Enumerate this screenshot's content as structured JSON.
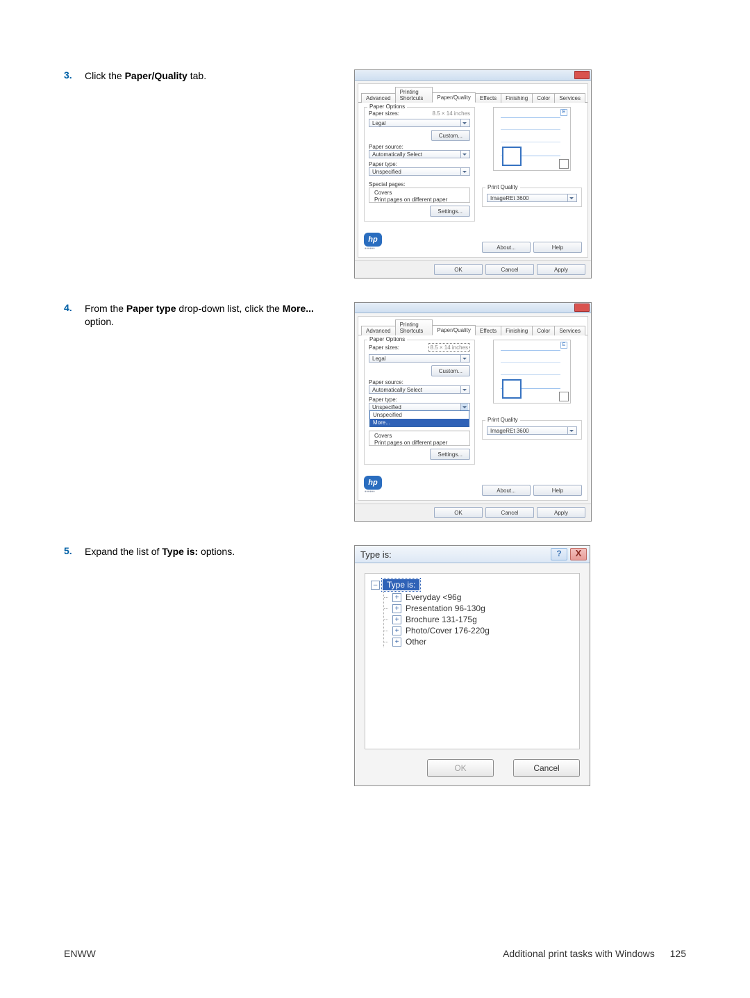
{
  "steps": {
    "s3": {
      "num": "3.",
      "text_before": "Click the ",
      "bold": "Paper/Quality",
      "text_after": " tab."
    },
    "s4": {
      "num": "4.",
      "text_before": "From the ",
      "bold1": "Paper type",
      "mid": " drop-down list, click the ",
      "bold2": "More...",
      "text_after": " option."
    },
    "s5": {
      "num": "5.",
      "text_before": "Expand the list of ",
      "bold": "Type is:",
      "text_after": " options."
    }
  },
  "dialog": {
    "tabs": {
      "advanced": "Advanced",
      "shortcuts": "Printing Shortcuts",
      "paperquality": "Paper/Quality",
      "effects": "Effects",
      "finishing": "Finishing",
      "color": "Color",
      "services": "Services"
    },
    "paper_options_legend": "Paper Options",
    "paper_sizes_lbl": "Paper sizes:",
    "paper_sizes_dim": "8.5 × 14 inches",
    "paper_size_val": "Legal",
    "custom_btn": "Custom...",
    "paper_source_lbl": "Paper source:",
    "paper_source_val": "Automatically Select",
    "paper_type_lbl": "Paper type:",
    "paper_type_val": "Unspecified",
    "dd_list_unspecified": "Unspecified",
    "dd_list_more": "More...",
    "special_pages_lbl": "Special pages:",
    "special_list_1": "Covers",
    "special_list_2": "Print pages on different paper",
    "settings_btn": "Settings...",
    "print_quality_legend": "Print Quality",
    "print_quality_val": "ImageREt 3600",
    "about_btn": "About...",
    "help_btn": "Help",
    "ok_btn": "OK",
    "cancel_btn": "Cancel",
    "apply_btn": "Apply",
    "hp_logo": "hp",
    "hp_side": "••••••",
    "preview_mark": "E"
  },
  "type_dialog": {
    "title": "Type is:",
    "root": "Type is:",
    "items": {
      "a": "Everyday <96g",
      "b": "Presentation 96-130g",
      "c": "Brochure 131-175g",
      "d": "Photo/Cover 176-220g",
      "e": "Other"
    },
    "help": "?",
    "close": "X",
    "ok": "OK",
    "cancel": "Cancel"
  },
  "footer": {
    "left": "ENWW",
    "right_text": "Additional print tasks with Windows",
    "page": "125"
  }
}
